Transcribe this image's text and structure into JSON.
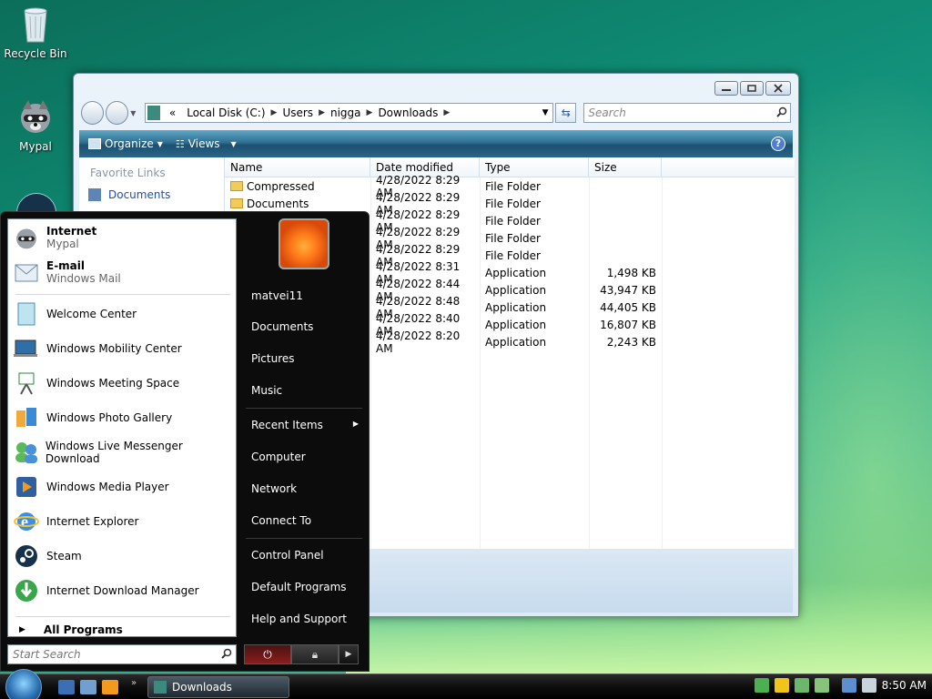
{
  "desktop": {
    "icons": [
      {
        "label": "Recycle Bin",
        "icon": "recycle-bin-icon"
      },
      {
        "label": "Mypal",
        "icon": "mypal-raccoon-icon"
      }
    ]
  },
  "explorer": {
    "window_buttons": [
      "minimize",
      "restore",
      "close"
    ],
    "address": {
      "prefix": "«",
      "crumbs": [
        "Local Disk (C:)",
        "Users",
        "nigga",
        "Downloads"
      ]
    },
    "search_placeholder": "Search",
    "toolbar": {
      "organize": "Organize",
      "views": "Views"
    },
    "nav_pane": {
      "heading": "Favorite Links",
      "links": [
        "Documents"
      ]
    },
    "columns": [
      "Name",
      "Date modified",
      "Type",
      "Size"
    ],
    "rows": [
      {
        "name": "Compressed",
        "date": "4/28/2022 8:29 AM",
        "type": "File Folder",
        "size": ""
      },
      {
        "name": "Documents",
        "date": "4/28/2022 8:29 AM",
        "type": "File Folder",
        "size": ""
      },
      {
        "name": "",
        "date": "4/28/2022 8:29 AM",
        "type": "File Folder",
        "size": ""
      },
      {
        "name": "",
        "date": "4/28/2022 8:29 AM",
        "type": "File Folder",
        "size": ""
      },
      {
        "name": "",
        "date": "4/28/2022 8:29 AM",
        "type": "File Folder",
        "size": ""
      },
      {
        "name": "",
        "date": "4/28/2022 8:31 AM",
        "type": "Application",
        "size": "1,498 KB"
      },
      {
        "name": "",
        "date": "4/28/2022 8:44 AM",
        "type": "Application",
        "size": "43,947 KB"
      },
      {
        "name": "",
        "date": "4/28/2022 8:48 AM",
        "type": "Application",
        "size": "44,405 KB"
      },
      {
        "name": "",
        "date": "4/28/2022 8:40 AM",
        "type": "Application",
        "size": "16,807 KB"
      },
      {
        "name": "",
        "date": "4/28/2022 8:20 AM",
        "type": "Application",
        "size": "2,243 KB"
      }
    ]
  },
  "start_menu": {
    "pinned": [
      {
        "title": "Internet",
        "subtitle": "Mypal"
      },
      {
        "title": "E-mail",
        "subtitle": "Windows Mail"
      }
    ],
    "recent": [
      "Welcome Center",
      "Windows Mobility Center",
      "Windows Meeting Space",
      "Windows Photo Gallery",
      "Windows Live Messenger Download",
      "Windows Media Player",
      "Internet Explorer",
      "Steam",
      "Internet Download Manager"
    ],
    "all_programs": "All Programs",
    "search_placeholder": "Start Search",
    "right": {
      "user": "matvei11",
      "items_a": [
        "Documents",
        "Pictures",
        "Music"
      ],
      "items_b": [
        "Recent Items",
        "Computer",
        "Network",
        "Connect To"
      ],
      "items_c": [
        "Control Panel",
        "Default Programs",
        "Help and Support"
      ]
    }
  },
  "taskbar": {
    "task_label": "Downloads",
    "clock": "8:50 AM"
  }
}
